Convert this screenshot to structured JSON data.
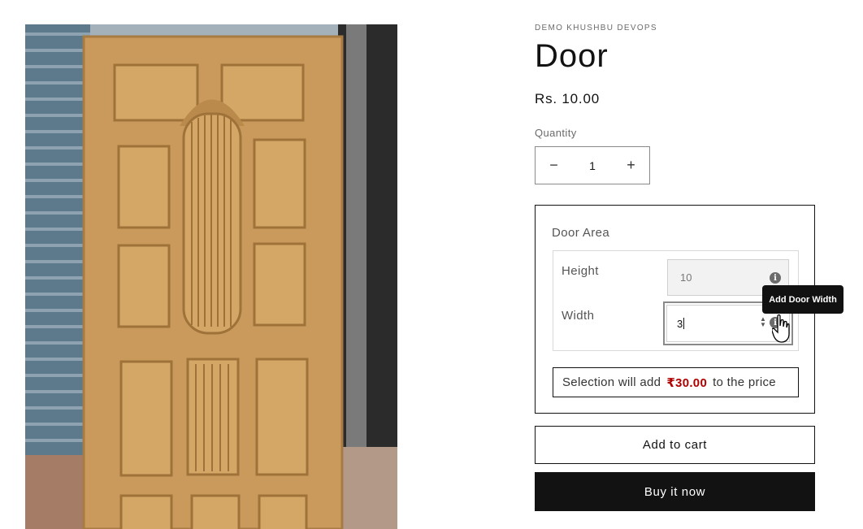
{
  "product": {
    "vendor": "DEMO KHUSHBU DEVOPS",
    "title": "Door",
    "price": "Rs. 10.00",
    "image_icon": "wooden-door-photo"
  },
  "quantity": {
    "label": "Quantity",
    "value": "1",
    "decrease_symbol": "−",
    "increase_symbol": "+"
  },
  "options": {
    "group_title": "Door Area",
    "height": {
      "label": "Height",
      "value": "10",
      "info_symbol": "i"
    },
    "width": {
      "label": "Width",
      "value": "3",
      "info_symbol": "i"
    },
    "tooltip": "Add Door Width",
    "summary": {
      "prefix": "Selection will add",
      "amount": "₹30.00",
      "suffix": "to the price"
    }
  },
  "actions": {
    "add_to_cart": "Add to cart",
    "buy_now": "Buy it now"
  },
  "colors": {
    "accent_price": "#b00000",
    "button_dark": "#121212"
  }
}
